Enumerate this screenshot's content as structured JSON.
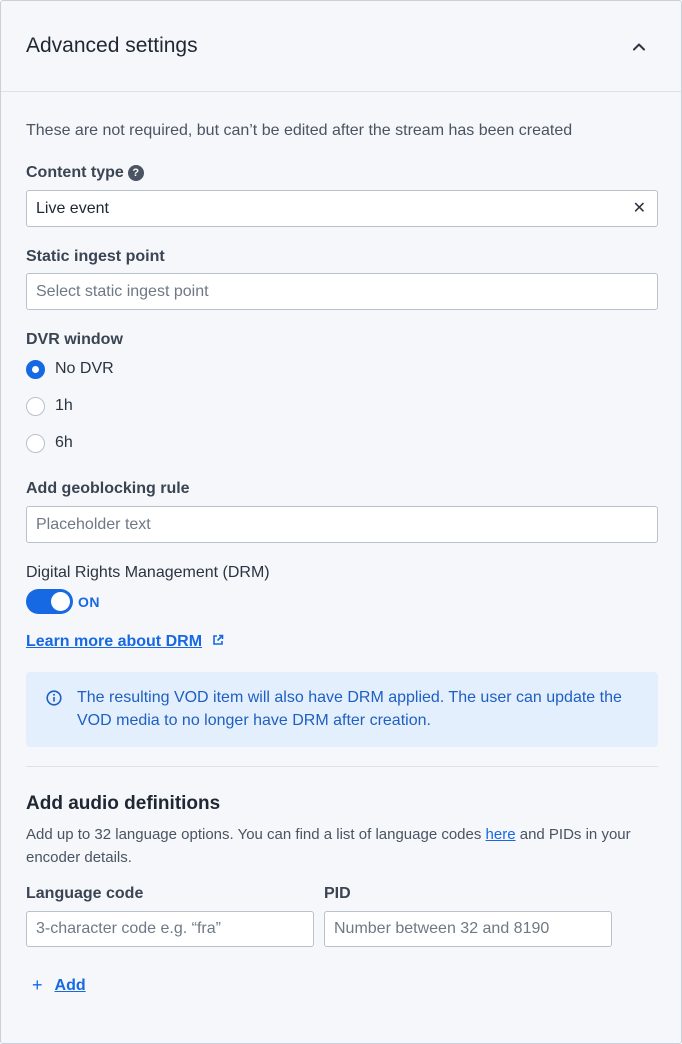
{
  "panel": {
    "title": "Advanced settings",
    "intro": "These are not required, but can’t be edited after the stream has been created"
  },
  "content_type": {
    "label": "Content type",
    "help_glyph": "?",
    "value": "Live event",
    "clear_glyph": "✕"
  },
  "static_ingest": {
    "label": "Static ingest point",
    "placeholder": "Select static ingest point"
  },
  "dvr": {
    "label": "DVR window",
    "options": [
      {
        "label": "No DVR",
        "checked": true
      },
      {
        "label": "1h",
        "checked": false
      },
      {
        "label": "6h",
        "checked": false
      }
    ]
  },
  "geoblocking": {
    "label": "Add geoblocking rule",
    "placeholder": "Placeholder text"
  },
  "drm": {
    "label": "Digital Rights Management (DRM)",
    "toggle_state": "ON",
    "enabled": true,
    "learn_more": "Learn more about DRM",
    "info": "The resulting VOD item will also have DRM applied. The user can update the VOD media to no longer have DRM after creation."
  },
  "audio": {
    "title": "Add audio definitions",
    "desc_before": "Add up to 32 language options. You can find a list of language codes ",
    "desc_link": "here",
    "desc_after": " and PIDs in your encoder details.",
    "language_label": "Language code",
    "language_placeholder": "3-character code e.g. “fra”",
    "pid_label": "PID",
    "pid_placeholder": "Number between 32 and 8190",
    "add_glyph": "+",
    "add_label": "Add"
  },
  "colors": {
    "accent": "#1668e3",
    "info_bg": "#e4effd",
    "info_text": "#1e5fc2",
    "panel_bg": "#f5f7fa"
  },
  "icons": [
    "chevron-up-icon",
    "help-icon",
    "close-icon",
    "external-link-icon",
    "info-icon",
    "plus-icon"
  ]
}
